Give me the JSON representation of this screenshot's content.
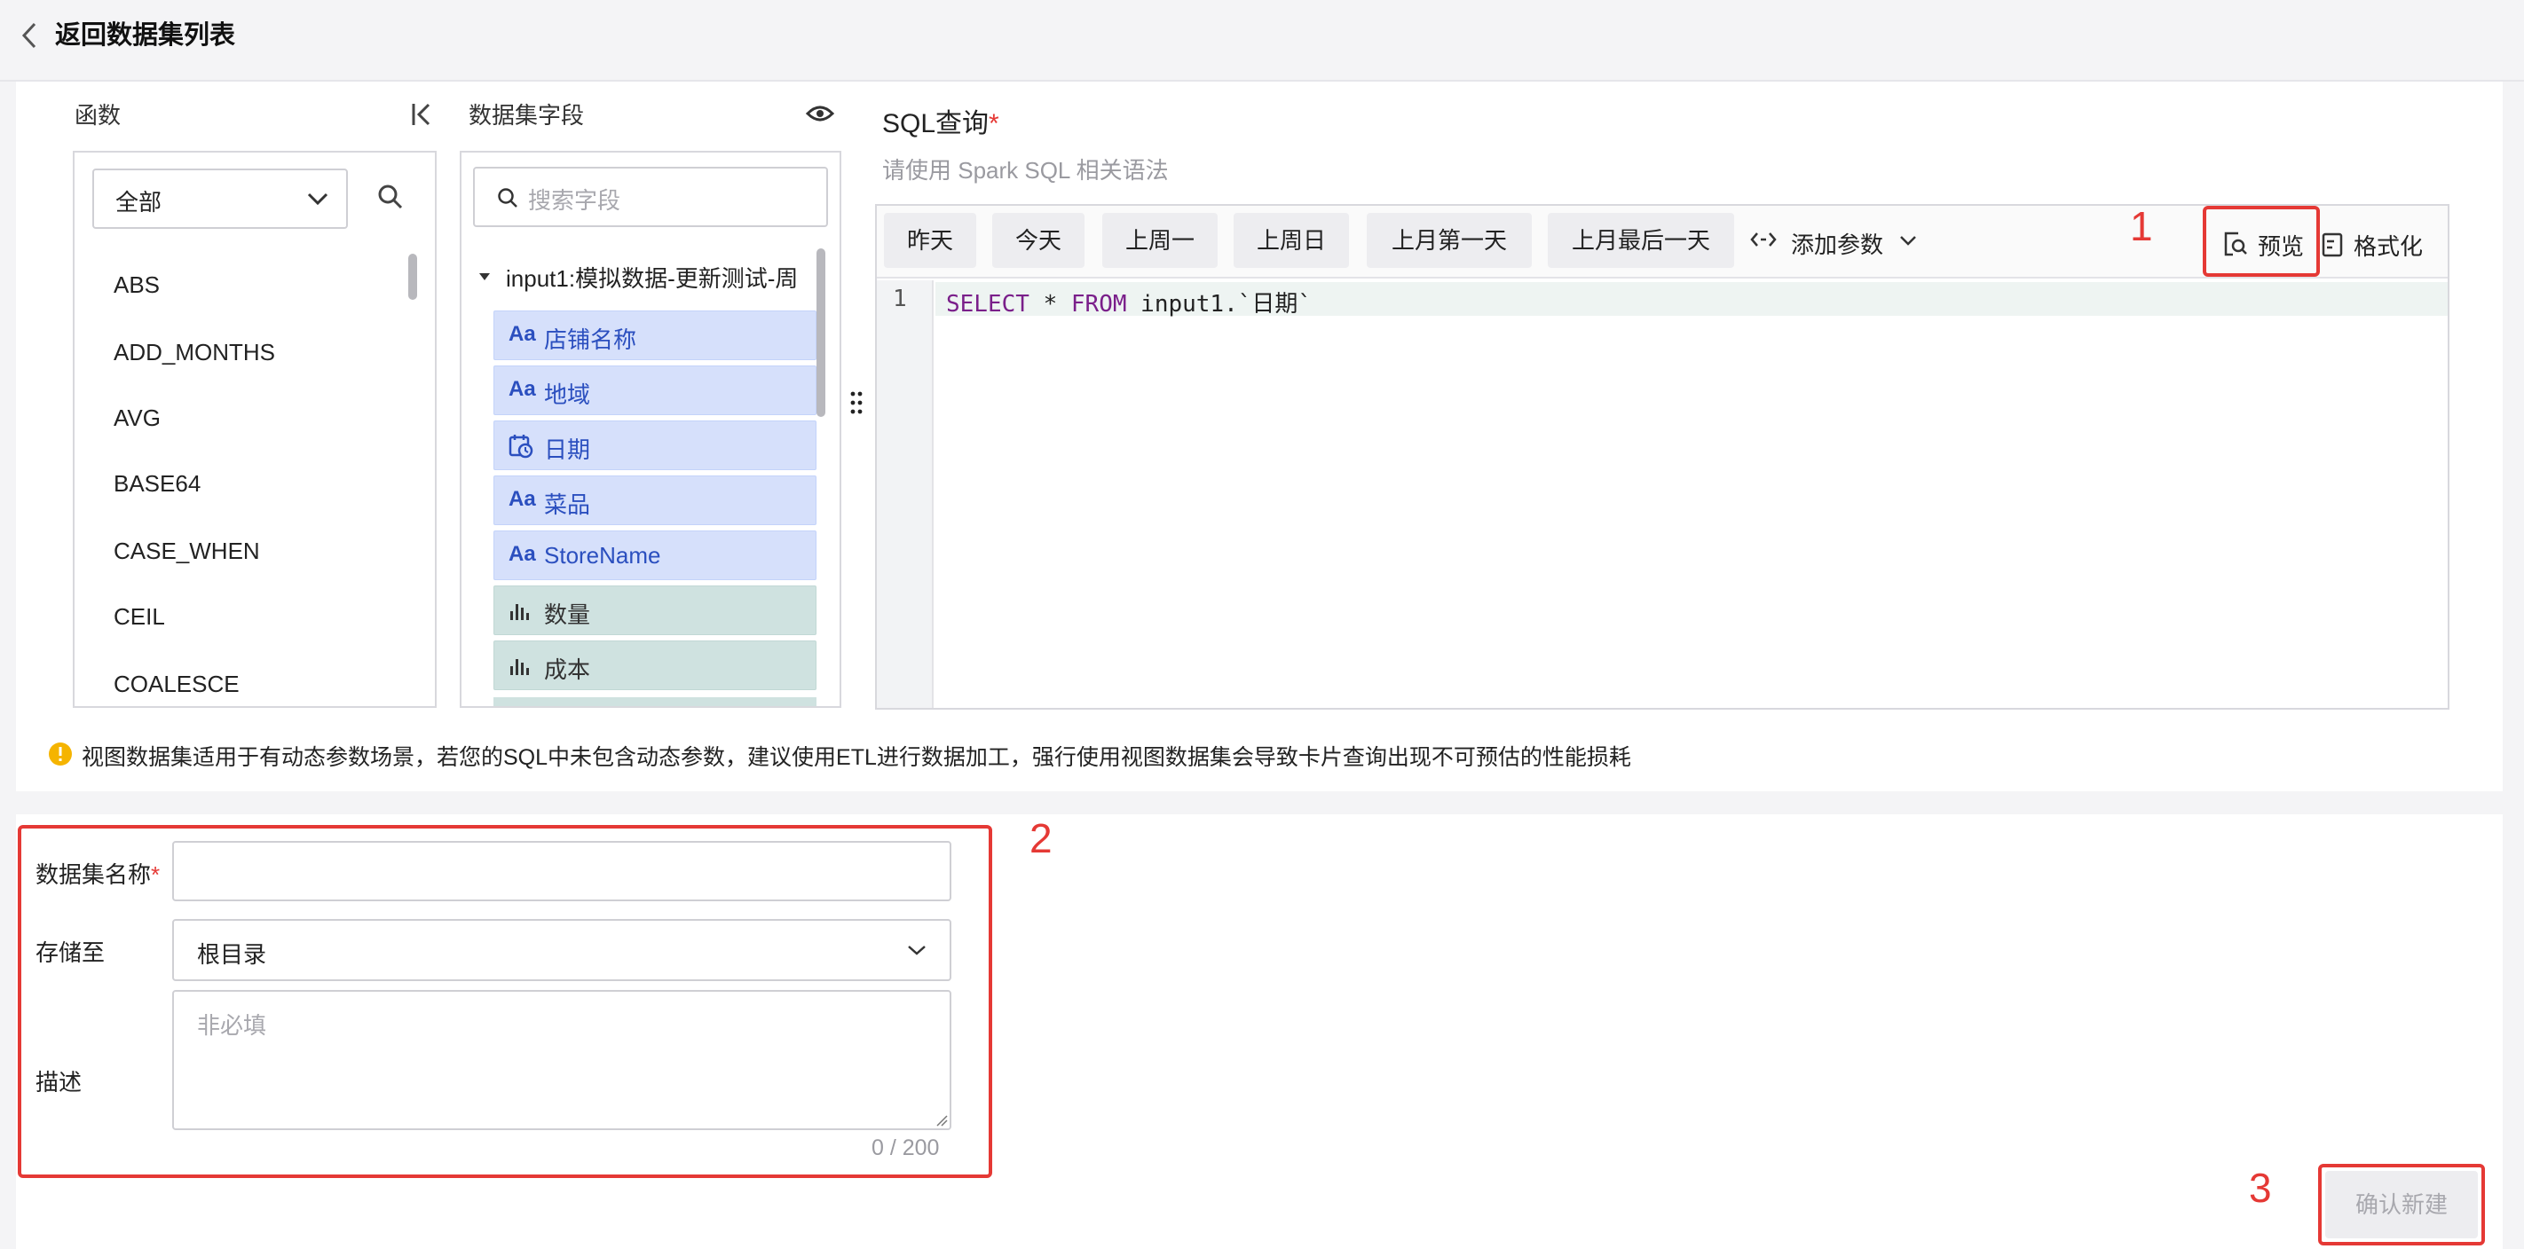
{
  "header": {
    "back_label": "返回数据集列表"
  },
  "functions": {
    "title": "函数",
    "filter_value": "全部",
    "items": [
      "ABS",
      "ADD_MONTHS",
      "AVG",
      "BASE64",
      "CASE_WHEN",
      "CEIL",
      "COALESCE"
    ]
  },
  "fields": {
    "title": "数据集字段",
    "search_placeholder": "搜索字段",
    "group": "input1:模拟数据-更新测试-周",
    "items": [
      {
        "type": "Aa",
        "name": "店铺名称",
        "kind": "dim"
      },
      {
        "type": "Aa",
        "name": "地域",
        "kind": "dim"
      },
      {
        "type": "date",
        "name": "日期",
        "kind": "dim"
      },
      {
        "type": "Aa",
        "name": "菜品",
        "kind": "dim"
      },
      {
        "type": "Aa",
        "name": "StoreName",
        "kind": "dim"
      },
      {
        "type": "measure",
        "name": "数量",
        "kind": "meas"
      },
      {
        "type": "measure",
        "name": "成本",
        "kind": "meas"
      }
    ]
  },
  "sql": {
    "title": "SQL查询",
    "required_mark": "*",
    "hint": "请使用 Spark SQL 相关语法",
    "quick_buttons": [
      "昨天",
      "今天",
      "上周一",
      "上周日",
      "上月第一天",
      "上月最后一天"
    ],
    "add_param": "添加参数",
    "preview": "预览",
    "format": "格式化",
    "line_no": "1",
    "code": {
      "kw1": "SELECT",
      "star": " * ",
      "kw2": "FROM",
      "rest": " input1.`日期`"
    }
  },
  "warning": "视图数据集适用于有动态参数场景，若您的SQL中未包含动态参数，建议使用ETL进行数据加工，强行使用视图数据集会导致卡片查询出现不可预估的性能损耗",
  "form": {
    "name_label": "数据集名称",
    "required_mark": "*",
    "name_value": "",
    "store_label": "存储至",
    "store_value": "根目录",
    "desc_label": "描述",
    "desc_placeholder": "非必填",
    "counter": "0 / 200"
  },
  "submit": "确认新建",
  "markers": [
    "1",
    "2",
    "3"
  ],
  "colors": {
    "accent_red": "#e53935",
    "dim_field": "#d6e0fb",
    "measure_field": "#cfe2e0",
    "keyword": "#7a1f8a"
  }
}
